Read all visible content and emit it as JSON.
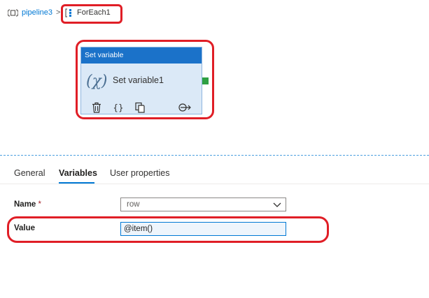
{
  "breadcrumb": {
    "pipeline": "pipeline3",
    "separator": ">",
    "current": "ForEach1"
  },
  "activity": {
    "type_label": "Set variable",
    "fx_symbol": "(χ)",
    "name": "Set variable1"
  },
  "tabs": [
    {
      "label": "General"
    },
    {
      "label": "Variables"
    },
    {
      "label": "User properties"
    }
  ],
  "form": {
    "name_label": "Name",
    "required_mark": "*",
    "name_value": "row",
    "value_label": "Value",
    "value_text": "@item()"
  },
  "colors": {
    "accent": "#0078d4",
    "card_header": "#1b72c9",
    "annotation": "#e01e26",
    "success_port": "#2ea043"
  },
  "icons": [
    "pipeline-icon",
    "foreach-icon",
    "delete-icon",
    "code-icon",
    "copy-icon",
    "add-output-icon",
    "chevron-down-icon"
  ]
}
